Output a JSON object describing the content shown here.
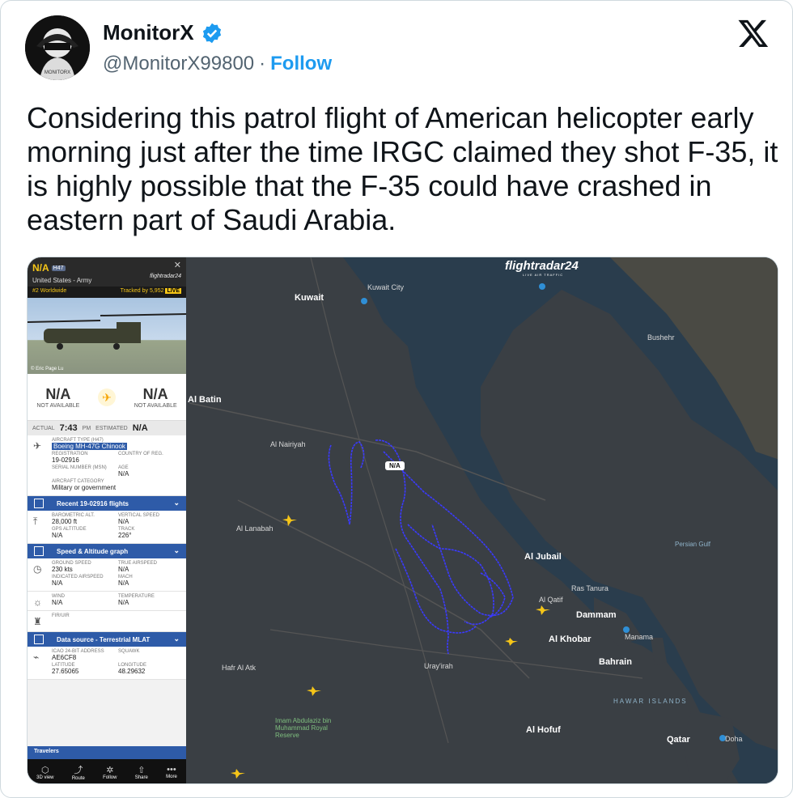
{
  "tweet": {
    "display_name": "MonitorX",
    "handle": "@MonitorX99800",
    "separator": "·",
    "follow_label": "Follow",
    "text": "Considering this patrol flight of American helicopter early morning just after the time IRGC claimed they shot F-35, it is highly possible that the F-35 could have crashed in eastern part of Saudi Arabia.",
    "icons": [
      "avatar",
      "verified-badge-icon",
      "x-logo-icon"
    ],
    "colors": {
      "follow": "#1d9bf0",
      "verified": "#1d9bf0",
      "text": "#0f1419",
      "muted": "#536471"
    }
  },
  "fr24": {
    "callsign": "N/A",
    "type_badge": "H47",
    "airline": "United States - Army",
    "brand": "flightradar24",
    "rank": "#2 Worldwide",
    "tracked": "Tracked by 5,952",
    "live": "LIVE",
    "photo_credit": "© Eric Page Lu",
    "origin_code": "N/A",
    "origin_sub": "NOT AVAILABLE",
    "dest_code": "N/A",
    "dest_sub": "NOT AVAILABLE",
    "actual_label": "ACTUAL",
    "actual_time": "7:43",
    "actual_ampm": "PM",
    "estimated_label": "ESTIMATED",
    "estimated_value": "N/A",
    "aircraft_type_label": "AIRCRAFT TYPE (H47)",
    "aircraft_type": "Boeing MH-47G Chinook",
    "registration_label": "REGISTRATION",
    "registration": "19-02916",
    "country_label": "COUNTRY OF REG.",
    "serial_label": "SERIAL NUMBER (MSN)",
    "age_label": "AGE",
    "age": "N/A",
    "category_label": "AIRCRAFT CATEGORY",
    "category": "Military or government",
    "recent_flights": "Recent 19-02916 flights",
    "baro_label": "BAROMETRIC ALT.",
    "baro": "28,000 ft",
    "vspeed_label": "VERTICAL SPEED",
    "vspeed": "N/A",
    "gps_label": "GPS ALTITUDE",
    "gps": "N/A",
    "track_label": "TRACK",
    "track": "226°",
    "speed_graph": "Speed & Altitude graph",
    "ground_label": "GROUND SPEED",
    "ground": "230 kts",
    "tas_label": "TRUE AIRSPEED",
    "tas": "N/A",
    "ias_label": "INDICATED AIRSPEED",
    "ias": "N/A",
    "mach_label": "MACH",
    "mach": "N/A",
    "wind_label": "WIND",
    "wind": "N/A",
    "temp_label": "TEMPERATURE",
    "temp": "N/A",
    "fir_label": "FIR/UIR",
    "data_source": "Data source - Terrestrial MLAT",
    "icao_label": "ICAO 24-BIT ADDRESS",
    "icao": "AE6CF8",
    "squawk_label": "SQUAWK",
    "lat_label": "LATITUDE",
    "lat": "27.65065",
    "lon_label": "LONGITUDE",
    "lon": "48.29632",
    "travelers": "Travelers",
    "bottom": [
      {
        "label": "3D view",
        "icon": "cube-icon"
      },
      {
        "label": "Route",
        "icon": "route-icon"
      },
      {
        "label": "Follow",
        "icon": "follow-icon"
      },
      {
        "label": "Share",
        "icon": "share-icon"
      },
      {
        "label": "More",
        "icon": "more-icon"
      }
    ]
  },
  "map": {
    "logo": "flightradar24",
    "logo_sub": "LIVE AIR TRAFFIC",
    "aircraft_tag": "N/A",
    "labels": {
      "kuwait": "Kuwait",
      "kuwait_city": "Kuwait City",
      "al_batin": "Al Batin",
      "al_jubail": "Al Jubail",
      "dammam": "Dammam",
      "al_khobar": "Al Khobar",
      "bahrain": "Bahrain",
      "manama": "Manama",
      "qatar": "Qatar",
      "al_hofuf": "Al Hofuf",
      "bushehr": "Bushehr",
      "ras_tanura": "Ras Tanura",
      "al_qatif": "Al Qatif",
      "hawar_islands": "HAWAR ISLANDS",
      "persian_gulf": "Persian Gulf",
      "al_nairyah": "Al Nairiyah",
      "hafr_al_batin": "Hafr Al Atk",
      "udhailiyah": "Uray'irah",
      "al_lanaabah": "Al Lanabah",
      "reserve": "Imam Abdulaziz bin Muhammad Royal Reserve",
      "doha": "Doha"
    },
    "colors": {
      "track": "#3a3aff",
      "land": "#3a3f44",
      "sea": "#2a3d4d"
    }
  }
}
